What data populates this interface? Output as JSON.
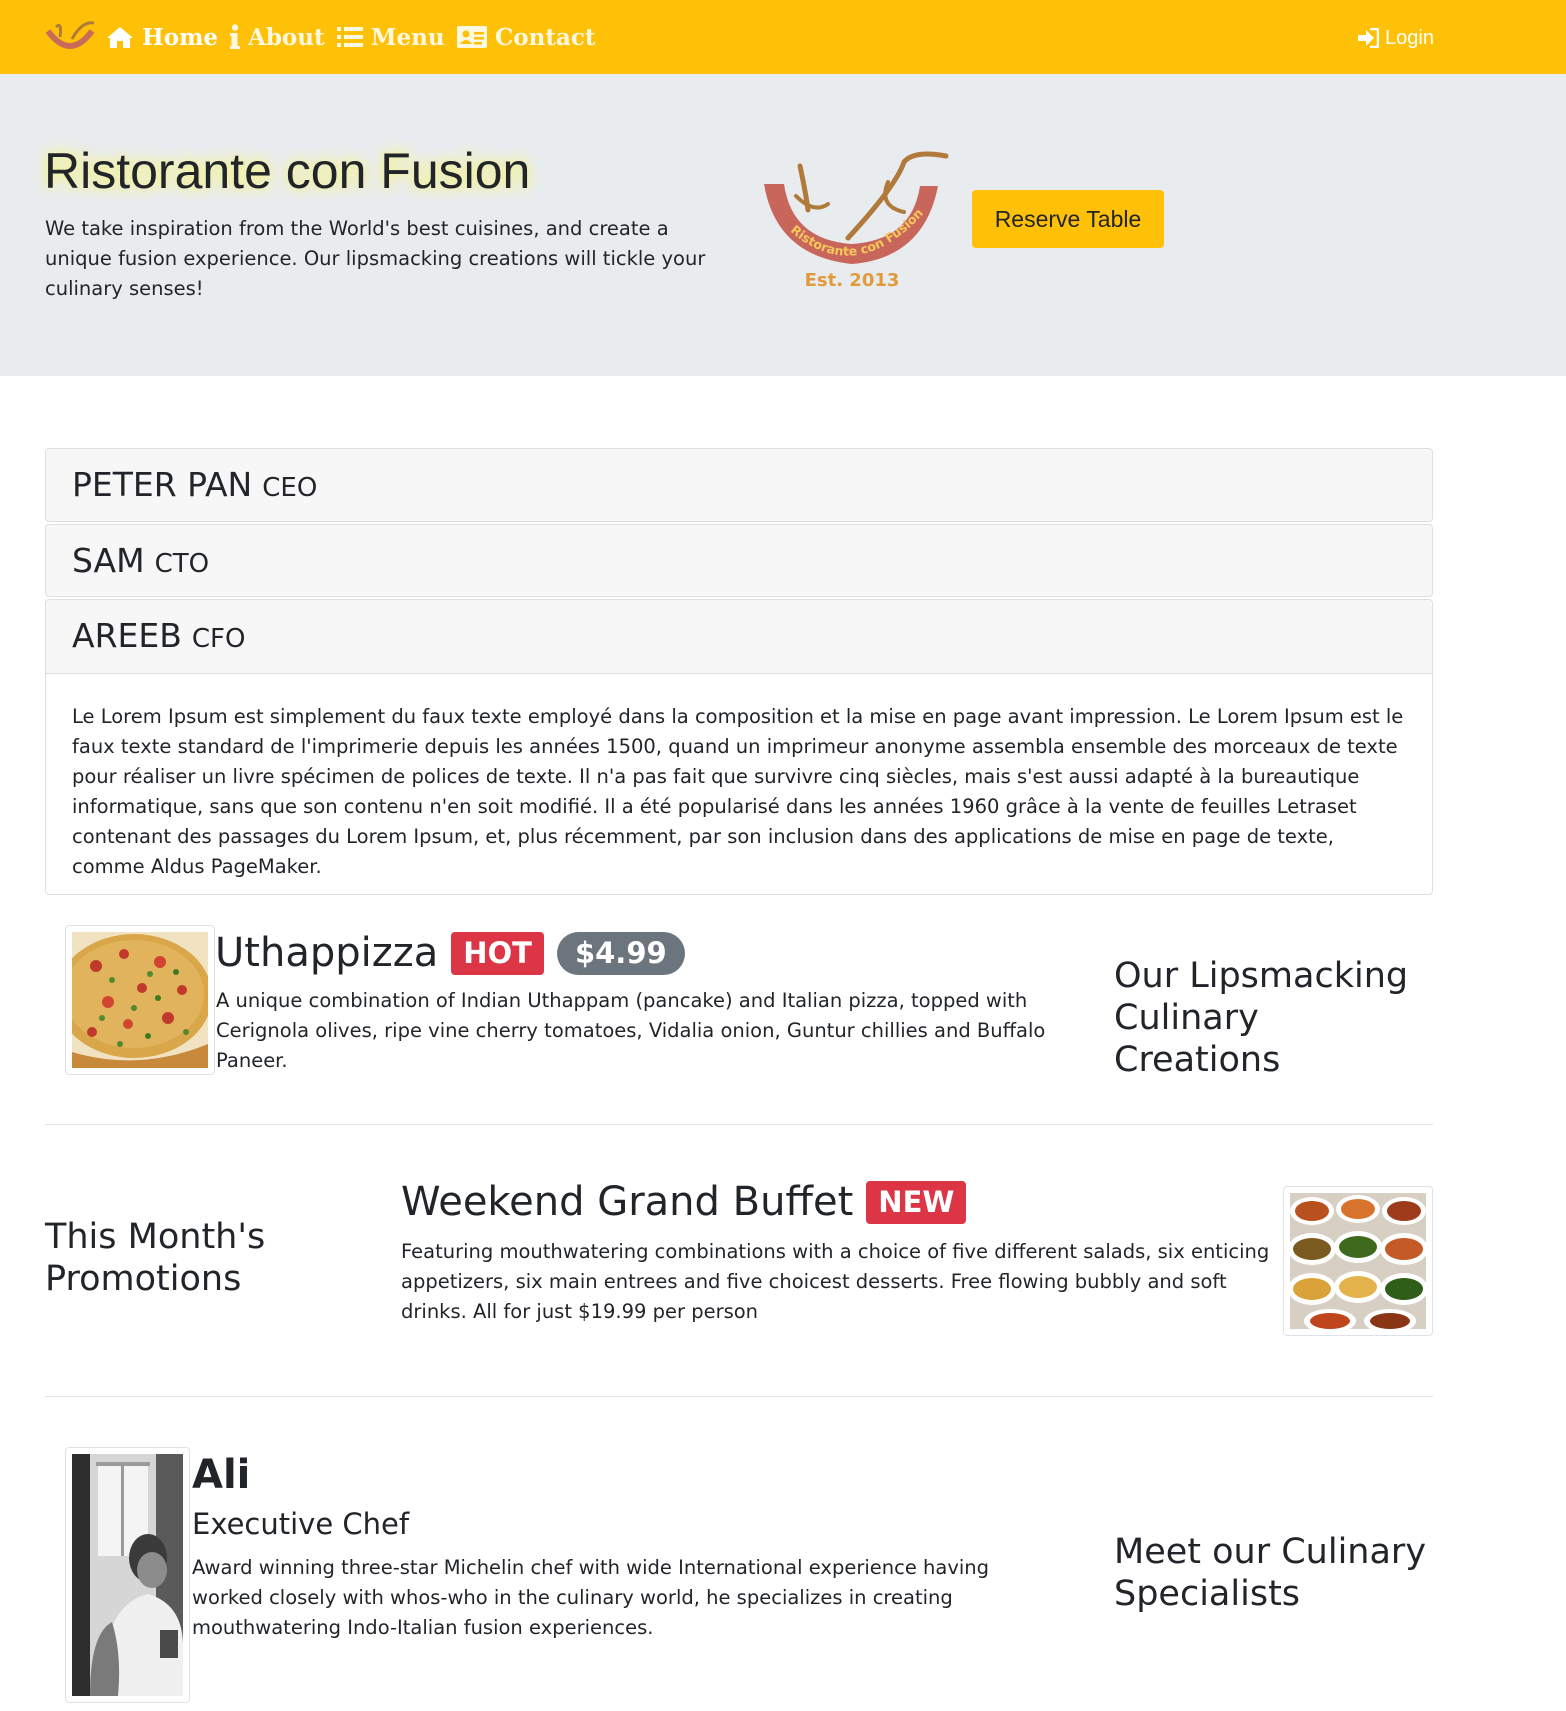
{
  "navbar": {
    "brand_logo": "ristorante-logo",
    "items": [
      {
        "label": "Home",
        "icon": "home-icon",
        "active": true
      },
      {
        "label": "About",
        "icon": "info-icon",
        "active": false
      },
      {
        "label": "Menu",
        "icon": "list-icon",
        "active": false
      },
      {
        "label": "Contact",
        "icon": "address-card-icon",
        "active": false
      }
    ],
    "login": {
      "label": "Login",
      "icon": "sign-in-icon"
    },
    "color": "#ffc107"
  },
  "jumbotron": {
    "title": "Ristorante con Fusion",
    "text": "We take inspiration from the World's best cuisines, and create a unique fusion experience. Our lipsmacking creations will tickle your culinary senses!",
    "logo": {
      "ring_text": "Ristorante con Fusion",
      "est": "Est. 2013"
    },
    "reserve_button": "Reserve Table",
    "background": "#e9ecef"
  },
  "accordion": {
    "items": [
      {
        "name": "PETER PAN",
        "role": "CEO"
      },
      {
        "name": "SAM",
        "role": "CTO"
      },
      {
        "name": "AREEB",
        "role": "CFO"
      }
    ],
    "expanded_body": "Le Lorem Ipsum est simplement du faux texte employé dans la composition et la mise en page avant impression. Le Lorem Ipsum est le faux texte standard de l'imprimerie depuis les années 1500, quand un imprimeur anonyme assembla ensemble des morceaux de texte pour réaliser un livre spécimen de polices de texte. Il n'a pas fait que survivre cinq siècles, mais s'est aussi adapté à la bureautique informatique, sans que son contenu n'en soit modifié. Il a été popularisé dans les années 1960 grâce à la vente de feuilles Letraset contenant des passages du Lorem Ipsum, et, plus récemment, par son inclusion dans des applications de mise en page de texte, comme Aldus PageMaker."
  },
  "dish": {
    "heading": "Our Lipsmacking Culinary Creations",
    "name": "Uthappizza",
    "badge": "HOT",
    "price": "$4.99",
    "description": "A unique combination of Indian Uthappam (pancake) and Italian pizza, topped with Cerignola olives, ripe vine cherry tomatoes, Vidalia onion, Guntur chillies and Buffalo Paneer."
  },
  "promotion": {
    "heading": "This Month's Promotions",
    "name": "Weekend Grand Buffet",
    "badge": "NEW",
    "description": "Featuring mouthwatering combinations with a choice of five different salads, six enticing appetizers, six main entrees and five choicest desserts. Free flowing bubbly and soft drinks. All for just $19.99 per person"
  },
  "leader": {
    "heading": "Meet our Culinary Specialists",
    "name": "Ali",
    "designation": "Executive Chef",
    "description": "Award winning three-star Michelin chef with wide International experience having worked closely with whos-who in the culinary world, he specializes in creating mouthwatering Indo-Italian fusion experiences."
  }
}
